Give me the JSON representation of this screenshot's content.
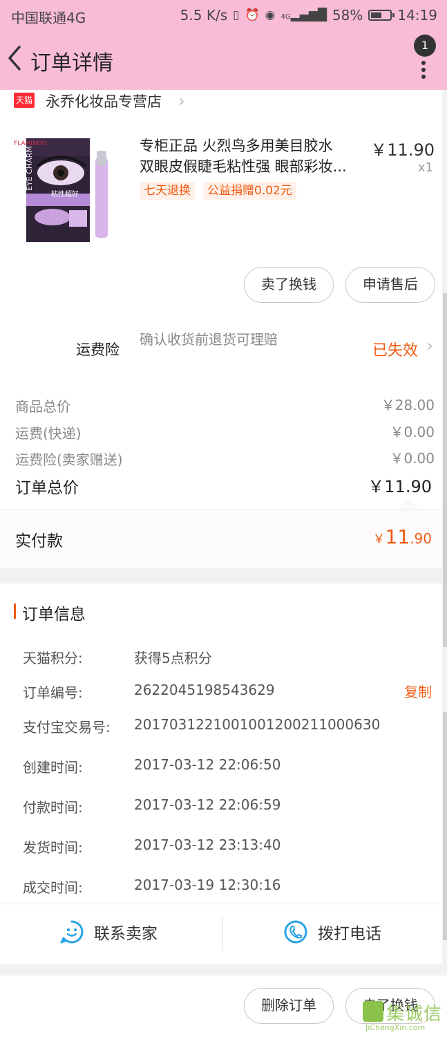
{
  "status_bar": {
    "carrier": "中国联通4G",
    "speed": "5.5 K/s",
    "network": "4G",
    "battery": "58%",
    "battery_level": 0.58,
    "time": "14:19"
  },
  "header": {
    "title": "订单详情",
    "badge": "1"
  },
  "shop": {
    "logo_text": "天猫",
    "name": "永乔化妆品专营店"
  },
  "product": {
    "title_line1": "专柜正品 火烈鸟多用美目胶水",
    "title_line2": "双眼皮假睫毛粘性强 眼部彩妆...",
    "price": "￥11.90",
    "qty": "x1",
    "tags": [
      "七天退换",
      "公益捐赠0.02元"
    ],
    "image_texts": {
      "brand": "FLAMINGO",
      "line": "EYE CHARM",
      "sticker": "粘性超好"
    }
  },
  "item_actions": {
    "sell_exchange": "卖了换钱",
    "after_sale": "申请售后"
  },
  "insurance": {
    "label": "运费险",
    "desc": "确认收货前退货可理赔",
    "status": "已失效"
  },
  "price_rows": [
    {
      "label": "商品总价",
      "value": "￥28.00"
    },
    {
      "label": "运费(快递)",
      "value": "￥0.00"
    },
    {
      "label": "运费险(卖家赠送)",
      "value": "￥0.00"
    }
  ],
  "total": {
    "label": "订单总价",
    "value": "￥11.90"
  },
  "paid": {
    "label": "实付款",
    "currency": "￥",
    "int": "11",
    "dec": ".90"
  },
  "order_info": {
    "title": "订单信息",
    "rows": [
      {
        "label": "天猫积分:",
        "value": "获得5点积分"
      },
      {
        "label": "订单编号:",
        "value": "2622045198543629"
      },
      {
        "label": "支付宝交易号:",
        "value": "2017031221001001200211000630"
      },
      {
        "label": "创建时间:",
        "value": "2017-03-12 22:06:50"
      },
      {
        "label": "付款时间:",
        "value": "2017-03-12 22:06:59"
      },
      {
        "label": "发货时间:",
        "value": "2017-03-12 23:13:40"
      },
      {
        "label": "成交时间:",
        "value": "2017-03-19 12:30:16"
      }
    ],
    "copy": "复制"
  },
  "contact": {
    "seller": "联系卖家",
    "call": "拨打电话"
  },
  "bottom_actions": {
    "delete": "删除订单",
    "sell_exchange": "卖了换钱"
  },
  "watermark": {
    "cn": "集诚信",
    "en": "JiChengXin.com"
  },
  "colors": {
    "header_bg": "#f9bcd7",
    "accent": "#f05a10",
    "tmall_red": "#ff2a36"
  }
}
